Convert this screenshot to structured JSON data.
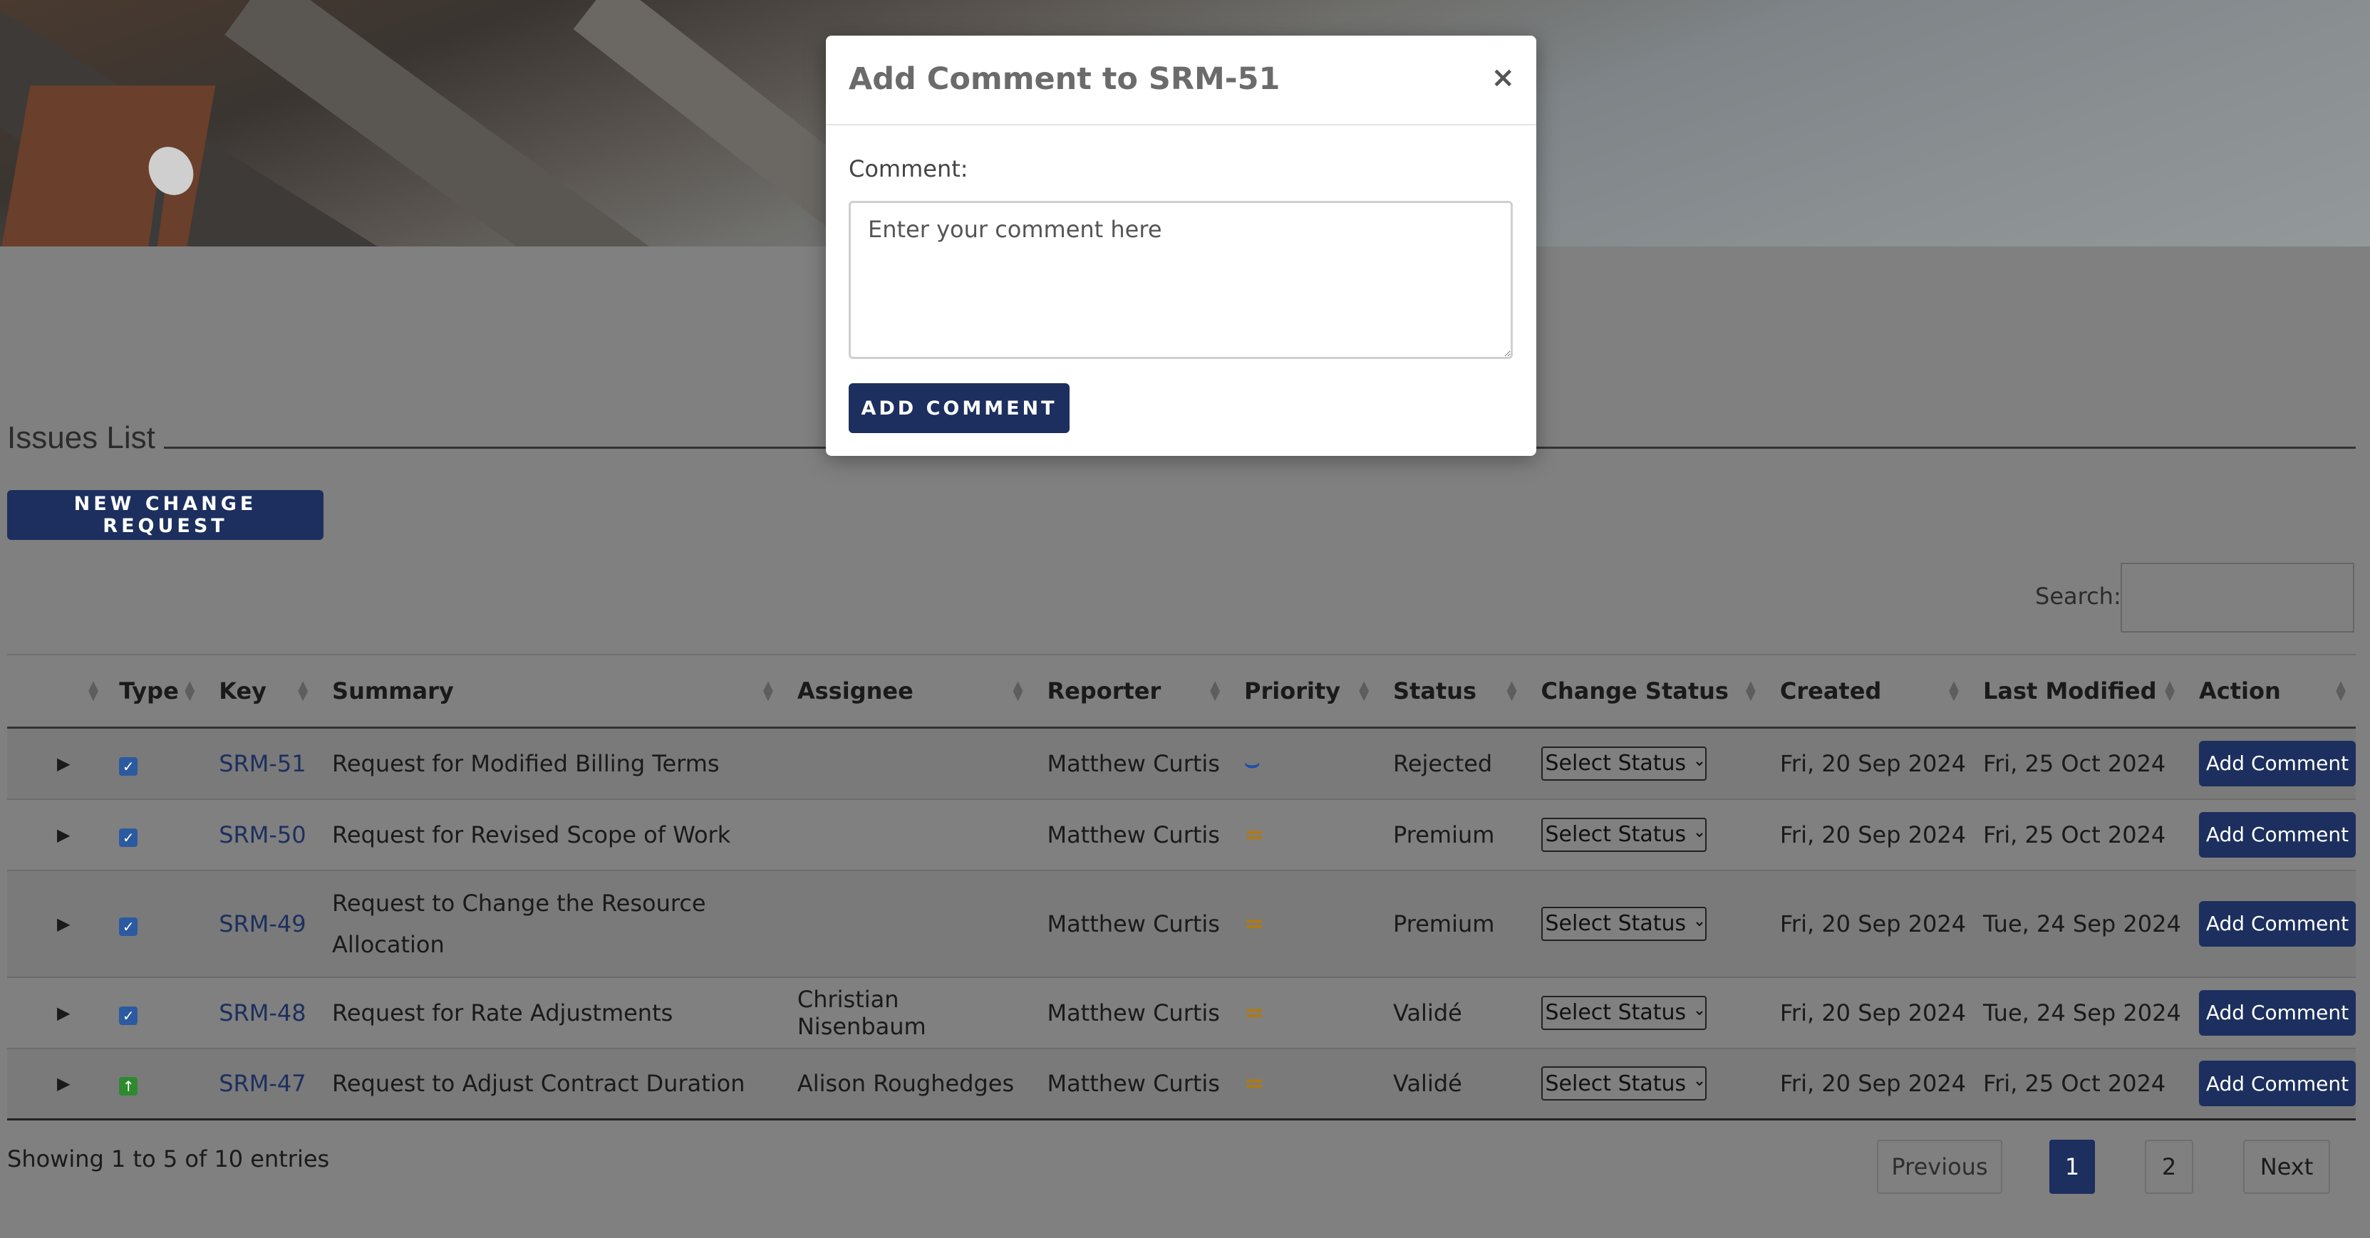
{
  "modal": {
    "title": "Add Comment to SRM-51",
    "close_glyph": "×",
    "comment_label": "Comment:",
    "comment_placeholder": "Enter your comment here",
    "comment_value": "",
    "submit_label": "ADD COMMENT"
  },
  "section": {
    "title": "Issues List",
    "new_button_label": "NEW CHANGE REQUEST"
  },
  "search": {
    "label": "Search:",
    "value": ""
  },
  "table": {
    "headers": [
      "",
      "Type",
      "Key",
      "Summary",
      "Assignee",
      "Reporter",
      "Priority",
      "Status",
      "Change Status",
      "Created",
      "Last Modified",
      "Action"
    ],
    "rows": [
      {
        "type": "task",
        "key": "SRM-51",
        "summary": "Request for Modified Billing Terms",
        "assignee": "",
        "reporter": "Matthew Curtis",
        "priority": "low",
        "priority_glyph": "⌣",
        "status": "Rejected",
        "change_status": "Select Status",
        "created": "Fri, 20 Sep 2024",
        "modified": "Fri, 25 Oct 2024",
        "action": "Add Comment"
      },
      {
        "type": "task",
        "key": "SRM-50",
        "summary": "Request for Revised Scope of Work",
        "assignee": "",
        "reporter": "Matthew Curtis",
        "priority": "medium",
        "priority_glyph": "=",
        "status": "Premium",
        "change_status": "Select Status",
        "created": "Fri, 20 Sep 2024",
        "modified": "Fri, 25 Oct 2024",
        "action": "Add Comment"
      },
      {
        "type": "task",
        "key": "SRM-49",
        "summary": "Request to Change the Resource Allocation",
        "assignee": "",
        "reporter": "Matthew Curtis",
        "priority": "medium",
        "priority_glyph": "=",
        "status": "Premium",
        "change_status": "Select Status",
        "created": "Fri, 20 Sep 2024",
        "modified": "Tue, 24 Sep 2024",
        "action": "Add Comment"
      },
      {
        "type": "task",
        "key": "SRM-48",
        "summary": "Request for Rate Adjustments",
        "assignee": "Christian Nisenbaum",
        "reporter": "Matthew Curtis",
        "priority": "medium",
        "priority_glyph": "=",
        "status": "Validé",
        "change_status": "Select Status",
        "created": "Fri, 20 Sep 2024",
        "modified": "Tue, 24 Sep 2024",
        "action": "Add Comment"
      },
      {
        "type": "improvement",
        "key": "SRM-47",
        "summary": "Request to Adjust Contract Duration",
        "assignee": "Alison Roughedges",
        "reporter": "Matthew Curtis",
        "priority": "medium",
        "priority_glyph": "=",
        "status": "Validé",
        "change_status": "Select Status",
        "created": "Fri, 20 Sep 2024",
        "modified": "Fri, 25 Oct 2024",
        "action": "Add Comment"
      }
    ]
  },
  "footer": {
    "entries_text": "Showing 1 to 5 of 10 entries",
    "pagination": {
      "previous": "Previous",
      "pages": [
        "1",
        "2"
      ],
      "current": "1",
      "next": "Next"
    }
  },
  "icons": {
    "expander": "expand-row-icon",
    "task_type": "checkbox-task-icon",
    "improvement_type": "arrow-up-improvement-icon",
    "sort": "sort-arrows-icon",
    "close": "close-icon"
  },
  "colors": {
    "primary_button": "#1c2f5e",
    "priority_low": "#1f4fa8",
    "priority_medium": "#b07a12",
    "type_task": "#2c5aa0",
    "type_improvement": "#2f8a2f"
  }
}
